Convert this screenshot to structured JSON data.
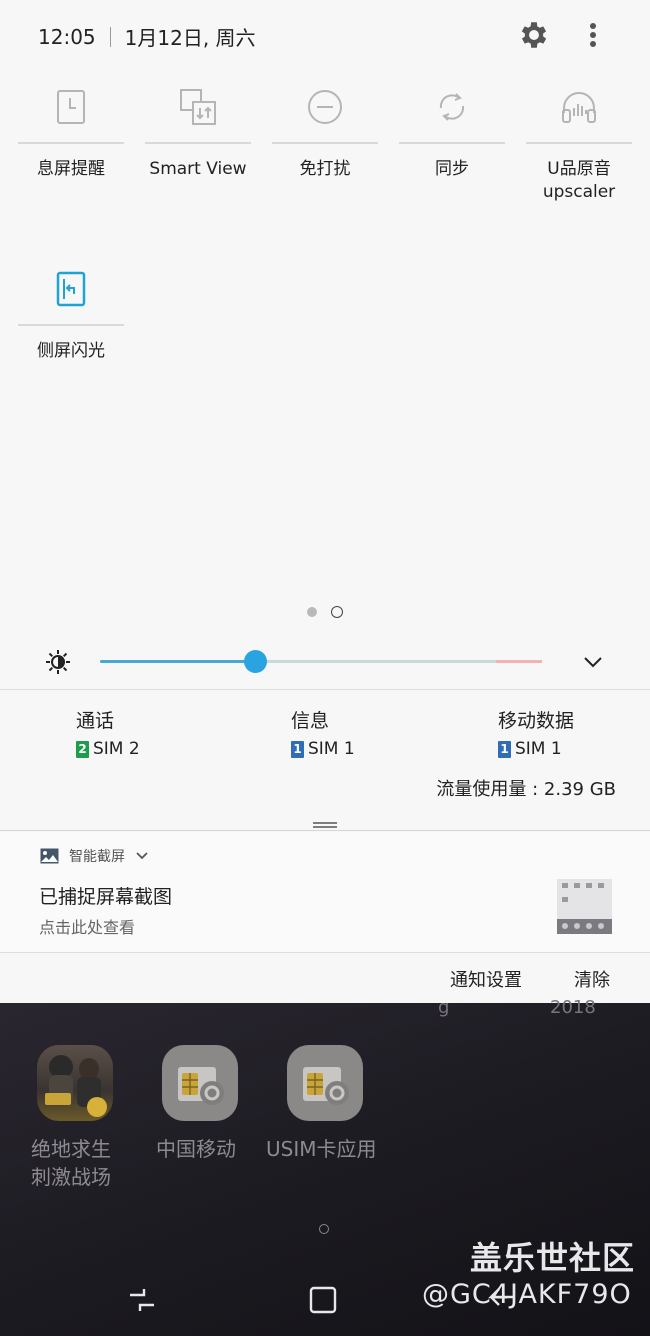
{
  "status_bar": {
    "time": "12:05",
    "date": "1月12日, 周六"
  },
  "quick_tiles": [
    {
      "label": "息屏提醒",
      "icon": "aod-icon",
      "active": false
    },
    {
      "label": "Smart View",
      "icon": "smart-view-icon",
      "active": false
    },
    {
      "label": "免打扰",
      "icon": "do-not-disturb-icon",
      "active": false
    },
    {
      "label": "同步",
      "icon": "sync-icon",
      "active": false
    },
    {
      "label": "U品原音\nupscaler",
      "icon": "uhq-upscaler-icon",
      "active": false
    },
    {
      "label": "侧屏闪光",
      "icon": "edge-lighting-icon",
      "active": true
    }
  ],
  "brightness": {
    "level": 0.35
  },
  "sim_info": [
    {
      "title": "通话",
      "sim_num": "2",
      "sim_label": "SIM 2",
      "color": "#1e9e4c"
    },
    {
      "title": "信息",
      "sim_num": "1",
      "sim_label": "SIM 1",
      "color": "#2f6db8"
    },
    {
      "title": "移动数据",
      "sim_num": "1",
      "sim_label": "SIM 1",
      "color": "#2f6db8"
    }
  ],
  "data_usage": "流量使用量 : 2.39 GB",
  "notification": {
    "app_name": "智能截屏",
    "title": "已捕捉屏幕截图",
    "subtitle": "点击此处查看"
  },
  "actions": {
    "settings": "通知设置",
    "clear": "清除"
  },
  "home_apps": [
    {
      "label": "绝地求生\n刺激战场",
      "icon": "pubg-icon"
    },
    {
      "label": "中国移动",
      "icon": "sim-card-icon"
    },
    {
      "label": "USIM卡应用",
      "icon": "sim-card-icon"
    }
  ],
  "watermark": {
    "line1": "盖乐世社区",
    "line2": "@GC4JAKF79O"
  },
  "colors": {
    "accent": "#2aa4e0",
    "edge_tile": "#1fa3d1",
    "panel_bg": "#f7f7f8"
  }
}
